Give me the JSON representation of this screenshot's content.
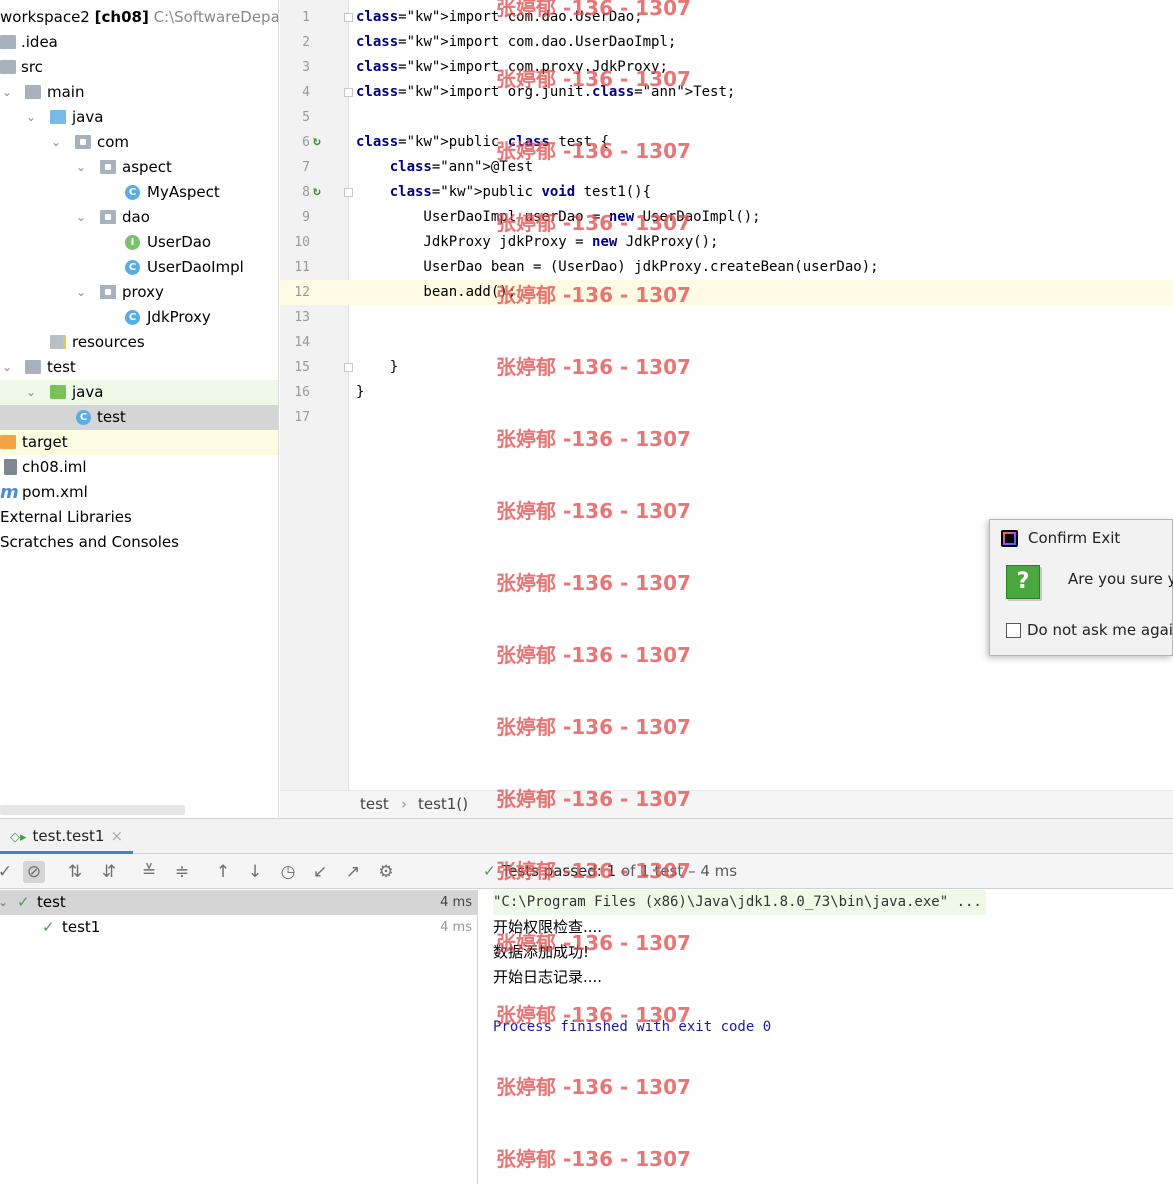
{
  "project_tree": {
    "header": {
      "name": "workspace2",
      "module": "[ch08]",
      "path": "C:\\SoftwareDepart"
    },
    "items": [
      {
        "label": ".idea"
      },
      {
        "label": "src"
      },
      {
        "label": "main"
      },
      {
        "label": "java"
      },
      {
        "label": "com"
      },
      {
        "label": "aspect"
      },
      {
        "label": "MyAspect",
        "badge": "C"
      },
      {
        "label": "dao"
      },
      {
        "label": "UserDao",
        "badge": "I"
      },
      {
        "label": "UserDaoImpl",
        "badge": "C"
      },
      {
        "label": "proxy"
      },
      {
        "label": "JdkProxy",
        "badge": "C"
      },
      {
        "label": "resources"
      },
      {
        "label": "test"
      },
      {
        "label": "java"
      },
      {
        "label": "test",
        "badge": "C"
      },
      {
        "label": "target"
      },
      {
        "label": "ch08.iml"
      },
      {
        "label": "pom.xml",
        "badge": "m"
      },
      {
        "label": "External Libraries"
      },
      {
        "label": "Scratches and Consoles"
      }
    ]
  },
  "editor": {
    "line_numbers": [
      "1",
      "2",
      "3",
      "4",
      "5",
      "6",
      "7",
      "8",
      "9",
      "10",
      "11",
      "12",
      "13",
      "14",
      "15",
      "16",
      "17"
    ],
    "lines": [
      "import com.dao.UserDao;",
      "import com.dao.UserDaoImpl;",
      "import com.proxy.JdkProxy;",
      "import org.junit.Test;",
      "",
      "public class test {",
      "    @Test",
      "    public void test1(){",
      "        UserDaoImpl userDao = new UserDaoImpl();",
      "        JdkProxy jdkProxy = new JdkProxy();",
      "        UserDao bean = (UserDao) jdkProxy.createBean(userDao);",
      "        bean.add();",
      "",
      "",
      "    }",
      "}",
      ""
    ],
    "breadcrumb": [
      "test",
      "test1()"
    ],
    "breadcrumb_sep": "›"
  },
  "run_panel": {
    "tab_label": "test.test1",
    "status": {
      "prefix": "Tests passed:",
      "count": "1",
      "rest": "of 1 test – 4 ms"
    },
    "results": [
      {
        "name": "test",
        "time": "4 ms"
      },
      {
        "name": "test1",
        "time": "4 ms"
      }
    ],
    "console": [
      "\"C:\\Program Files (x86)\\Java\\jdk1.8.0_73\\bin\\java.exe\" ...",
      "开始权限检查....",
      "数据添加成功!",
      "开始日志记录....",
      "",
      "Process finished with exit code 0"
    ]
  },
  "dialog": {
    "title": "Confirm Exit",
    "message": "Are you sure y",
    "checkbox_label": "Do not ask me again"
  },
  "watermark": "张婷郁 -136 - 1307"
}
